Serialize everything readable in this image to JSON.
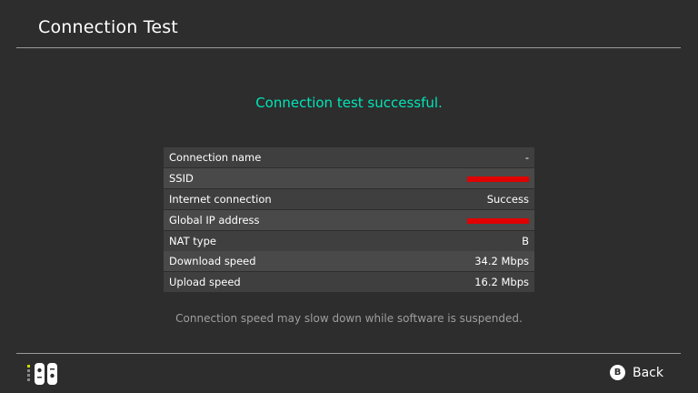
{
  "header": {
    "title": "Connection Test"
  },
  "status": {
    "message": "Connection test successful.",
    "color": "#00e6b8"
  },
  "results": [
    {
      "label": "Connection name",
      "value": "-"
    },
    {
      "label": "SSID",
      "value": "",
      "redacted": true
    },
    {
      "label": "Internet connection",
      "value": "Success"
    },
    {
      "label": "Global IP address",
      "value": "",
      "redacted": true
    },
    {
      "label": "NAT type",
      "value": "B"
    },
    {
      "label": "Download speed",
      "value": "34.2 Mbps"
    },
    {
      "label": "Upload speed",
      "value": "16.2 Mbps"
    }
  ],
  "note": "Connection speed may slow down while software is suspended.",
  "footer": {
    "controller_icon": "joy-con-controller-icon",
    "back_button_glyph": "B",
    "back_label": "Back"
  }
}
